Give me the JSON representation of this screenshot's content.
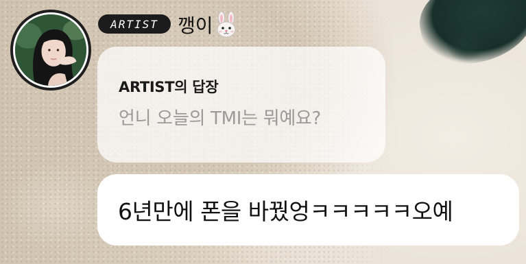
{
  "sender": {
    "badge": "ARTIST",
    "name": "깽이",
    "avatar_icon": "profile-photo",
    "name_emoji_icon": "rabbit-face-icon"
  },
  "reply": {
    "label": "ARTIST의 답장",
    "quoted_text": "언니 오늘의 TMI는 뭐예요?"
  },
  "message": {
    "text": "6년만에 폰을 바꿨엉ㅋㅋㅋㅋㅋ오예"
  },
  "colors": {
    "badge_bg": "#1c1c1c",
    "bubble_bg": "#ffffff",
    "quote_text": "#9a9a9a"
  }
}
